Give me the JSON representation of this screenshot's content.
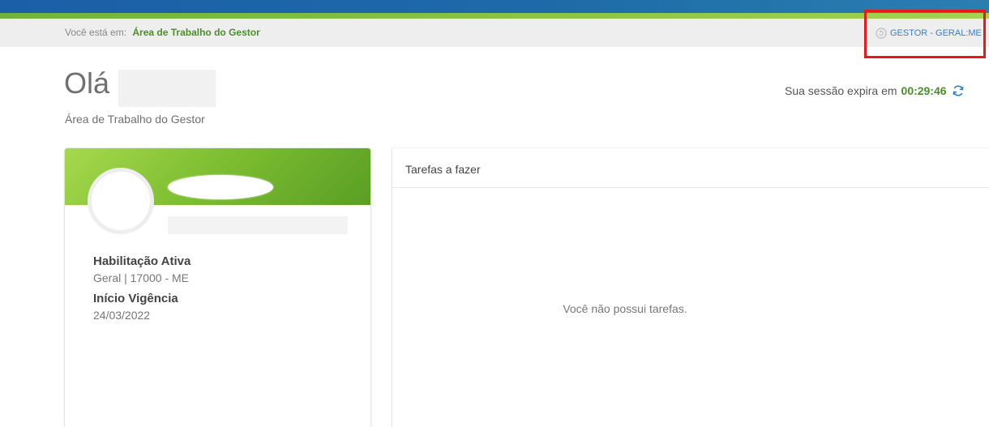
{
  "breadcrumb": {
    "prefix": "Você está em:",
    "current": "Área de Trabalho do Gestor"
  },
  "profile_switch": {
    "label": "GESTOR - GERAL:ME",
    "icon": "profile-switch-icon"
  },
  "header": {
    "greeting": "Olá",
    "subtitle": "Área de Trabalho do Gestor"
  },
  "session": {
    "label": "Sua sessão expira em",
    "time": "00:29:46",
    "icon": "refresh-icon"
  },
  "profile_card": {
    "habilitacao_label": "Habilitação Ativa",
    "habilitacao_value": "Geral | 17000 - ME",
    "vigencia_label": "Início Vigência",
    "vigencia_value": "24/03/2022"
  },
  "tasks": {
    "title": "Tarefas a fazer",
    "empty_message": "Você não possui tarefas."
  },
  "colors": {
    "accent_green": "#4a8f2a",
    "link_blue": "#3b7fc4",
    "highlight_red": "#e8191c"
  }
}
